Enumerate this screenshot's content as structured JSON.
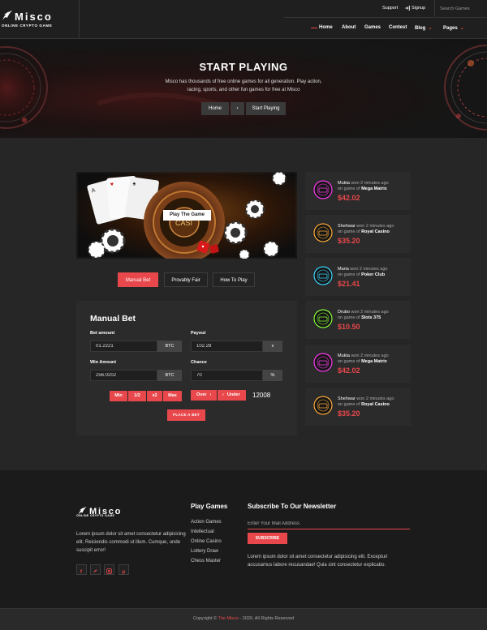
{
  "brand": {
    "name": "Misco",
    "tagline": "ONLINE CRYPTO GAME",
    "accent": "#e8484b"
  },
  "topbar": {
    "support": "Support",
    "signup": "Signup",
    "search_placeholder": "Search Games"
  },
  "nav": {
    "home": "Home",
    "about": "About",
    "games": "Games",
    "contest": "Contest",
    "blog": "Blog",
    "pages": "Pages"
  },
  "hero": {
    "title": "START PLAYING",
    "subtitle": "Misco has thousands of free online games for all generation. Play action, racing, sports, and other fun games for free at Misco",
    "crumb_home": "Home",
    "crumb_sep": "›",
    "crumb_current": "Start Playing"
  },
  "game": {
    "play_label": "Play The Game",
    "sign_text": "CASI"
  },
  "tabs": {
    "manual": "Manual Bet",
    "provably": "Provably Fair",
    "howto": "How To Play"
  },
  "bet": {
    "title": "Manual Bet",
    "bet_amount_label": "Bet amount",
    "bet_amount_value": "01.2221",
    "bet_amount_unit": "BTC",
    "payout_label": "Payout",
    "payout_value": "102.28",
    "payout_unit": "x",
    "win_amount_label": "Win Amount",
    "win_amount_value": "256.0202",
    "win_amount_unit": "BTC",
    "chance_label": "Chance",
    "chance_value": "70",
    "chance_unit": "%",
    "min": "Min",
    "half": "1/2",
    "double": "x2",
    "max": "Max",
    "over": "Over",
    "under": "Under",
    "target": "12008",
    "place": "PLACE A BET"
  },
  "winners": [
    {
      "user": "Mukta",
      "text": "won 2 minutes ago",
      "on": "on game of",
      "game": "Mega Matrix",
      "amount": "$42.02",
      "icon": "mega-matrix-icon",
      "color": "#ff3df0"
    },
    {
      "user": "Shehwar",
      "text": "won 2 minutes ago",
      "on": "on game of",
      "game": "Royal Casino",
      "amount": "$35.20",
      "icon": "royal-casino-icon",
      "color": "#ffae3d"
    },
    {
      "user": "Maria",
      "text": "won 2 minutes ago",
      "on": "on game of",
      "game": "Poker Club",
      "amount": "$21.41",
      "icon": "poker-club-icon",
      "color": "#3dd8ff"
    },
    {
      "user": "Drubo",
      "text": "won 2 minutes ago",
      "on": "on game of",
      "game": "Slots 375",
      "amount": "$10.50",
      "icon": "slots-icon",
      "color": "#8bff3d"
    },
    {
      "user": "Mukta",
      "text": "won 2 minutes ago",
      "on": "on game of",
      "game": "Mega Matrix",
      "amount": "$42.02",
      "icon": "mega-matrix-icon",
      "color": "#ff3df0"
    },
    {
      "user": "Shehwar",
      "text": "won 2 minutes ago",
      "on": "on game of",
      "game": "Royal Casino",
      "amount": "$35.20",
      "icon": "royal-casino-icon",
      "color": "#ffae3d"
    }
  ],
  "footer": {
    "about": "Lorem ipsum dolor sit amet consectetur adipisicing elit. Reiciendis commodi ut illum. Cumque, unde suscipit error!",
    "play_games_title": "Play Games",
    "links": [
      "Action Games",
      "Intellectual",
      "Online Casino",
      "Lottery Draw",
      "Chess Master"
    ],
    "newsletter_title": "Subscribe To Our Newsletter",
    "email_placeholder": "Enter Your Mail Address",
    "subscribe": "SUBSCRIBE",
    "newsletter_text": "Lorem ipsum dolor sit amet consectetur adipisicing elit. Excepturi accusamus labore recusandae! Quia sint consectetur explicabo.",
    "copyright_prefix": "Copyright ©",
    "copyright_brand": "The Misco",
    "copyright_suffix": "- 2020, All Rights Reserved"
  }
}
